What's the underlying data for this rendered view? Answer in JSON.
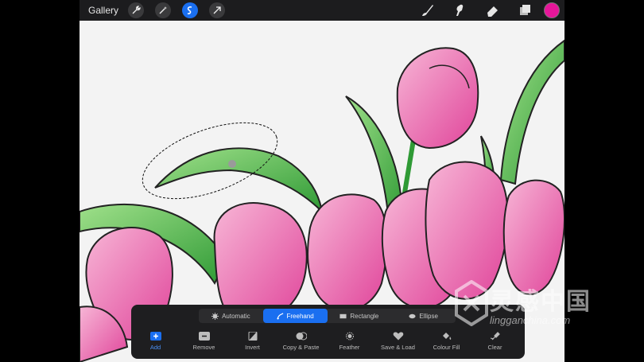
{
  "topbar": {
    "gallery_label": "Gallery",
    "left_tools": [
      "wrench-icon",
      "magic-wand-icon",
      "selection-icon",
      "transform-arrow-icon"
    ],
    "right_tools": [
      "brush-icon",
      "smudge-icon",
      "eraser-icon",
      "layers-icon"
    ],
    "active_color": "#e6169a"
  },
  "selection_panel": {
    "modes": [
      {
        "label": "Automatic",
        "icon": "automatic-icon"
      },
      {
        "label": "Freehand",
        "icon": "freehand-icon",
        "active": true
      },
      {
        "label": "Rectangle",
        "icon": "rectangle-icon"
      },
      {
        "label": "Ellipse",
        "icon": "ellipse-icon"
      }
    ],
    "actions": [
      {
        "label": "Add",
        "icon": "add-icon",
        "active": true
      },
      {
        "label": "Remove",
        "icon": "remove-icon"
      },
      {
        "label": "Invert",
        "icon": "invert-icon"
      },
      {
        "label": "Copy & Paste",
        "icon": "copy-paste-icon"
      },
      {
        "label": "Feather",
        "icon": "feather-icon"
      },
      {
        "label": "Save & Load",
        "icon": "save-load-icon"
      },
      {
        "label": "Colour Fill",
        "icon": "colour-fill-icon"
      },
      {
        "label": "Clear",
        "icon": "clear-icon"
      }
    ]
  },
  "watermark": {
    "chinese": "灵感中国",
    "site": "lingganchina.com"
  },
  "colors": {
    "accent": "#1a6ff0",
    "tulip_pink": "#e65aa8",
    "leaf_green": "#4fb84a"
  }
}
